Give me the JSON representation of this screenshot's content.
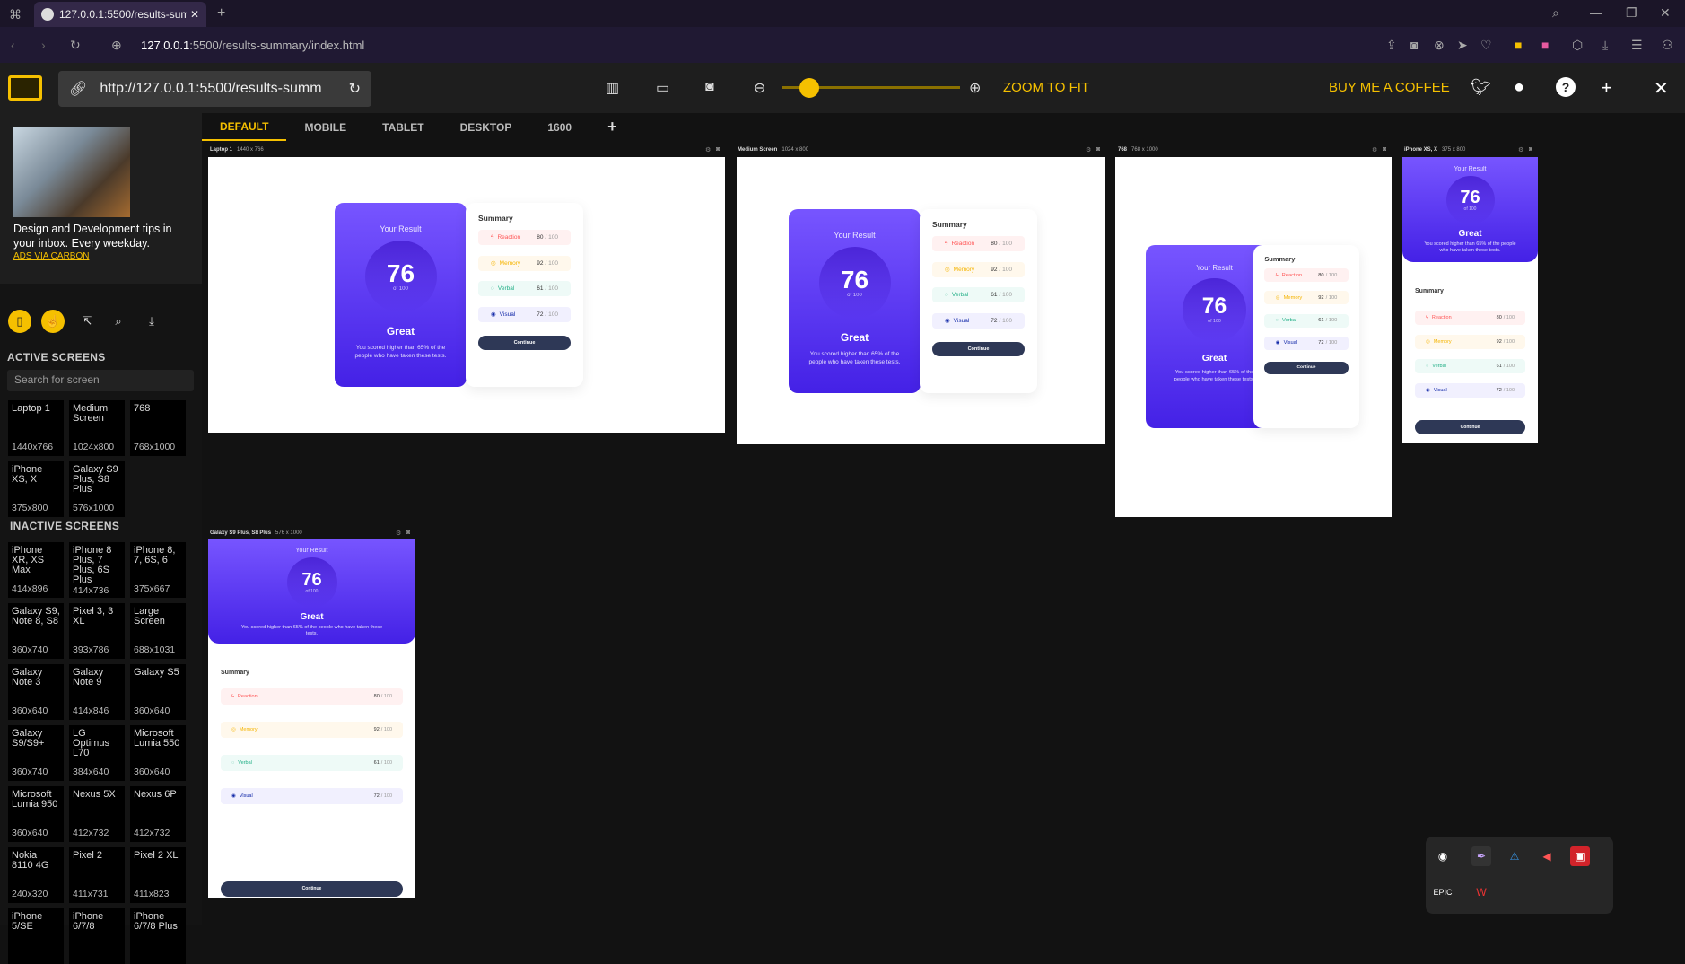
{
  "browser": {
    "tab_title": "127.0.0.1:5500/results-sum",
    "address_host": "127.0.0.1",
    "address_path": ":5500/results-summary/index.html"
  },
  "toolbar": {
    "url": "http://127.0.0.1:5500/results-summ",
    "zoom_label": "ZOOM TO FIT",
    "coffee_label": "BUY ME A COFFEE"
  },
  "view_tabs": [
    "DEFAULT",
    "MOBILE",
    "TABLET",
    "DESKTOP",
    "1600"
  ],
  "ad": {
    "text": "Design and Development tips in your inbox. Every weekday.",
    "link": "ADS VIA CARBON"
  },
  "sidebar": {
    "active_heading": "ACTIVE SCREENS",
    "search_placeholder": "Search for screen",
    "inactive_heading": "INACTIVE SCREENS",
    "active": [
      {
        "name": "Laptop 1",
        "size": "1440x766"
      },
      {
        "name": "Medium Screen",
        "size": "1024x800"
      },
      {
        "name": "768",
        "size": "768x1000"
      },
      {
        "name": "iPhone XS, X",
        "size": "375x800"
      },
      {
        "name": "Galaxy S9 Plus, S8 Plus",
        "size": "576x1000"
      }
    ],
    "inactive": [
      {
        "name": "iPhone XR, XS Max",
        "size": "414x896"
      },
      {
        "name": "iPhone 8 Plus, 7 Plus, 6S Plus",
        "size": "414x736"
      },
      {
        "name": "iPhone 8, 7, 6S, 6",
        "size": "375x667"
      },
      {
        "name": "Galaxy S9, Note 8, S8",
        "size": "360x740"
      },
      {
        "name": "Pixel 3, 3 XL",
        "size": "393x786"
      },
      {
        "name": "Large Screen",
        "size": "688x1031"
      },
      {
        "name": "Galaxy Note 3",
        "size": "360x640"
      },
      {
        "name": "Galaxy Note 9",
        "size": "414x846"
      },
      {
        "name": "Galaxy S5",
        "size": "360x640"
      },
      {
        "name": "Galaxy S9/S9+",
        "size": "360x740"
      },
      {
        "name": "LG Optimus L70",
        "size": "384x640"
      },
      {
        "name": "Microsoft Lumia 550",
        "size": "360x640"
      },
      {
        "name": "Microsoft Lumia 950",
        "size": "360x640"
      },
      {
        "name": "Nexus 5X",
        "size": "412x732"
      },
      {
        "name": "Nexus 6P",
        "size": "412x732"
      },
      {
        "name": "Nokia 8110 4G",
        "size": "240x320"
      },
      {
        "name": "Pixel 2",
        "size": "411x731"
      },
      {
        "name": "Pixel 2 XL",
        "size": "411x823"
      },
      {
        "name": "iPhone 5/SE",
        "size": ""
      },
      {
        "name": "iPhone 6/7/8",
        "size": ""
      },
      {
        "name": "iPhone 6/7/8 Plus",
        "size": ""
      }
    ]
  },
  "previews": [
    {
      "label": "Laptop 1",
      "size": "1440 x 766"
    },
    {
      "label": "Medium Screen",
      "size": "1024 x 800"
    },
    {
      "label": "768",
      "size": "768 x 1000"
    },
    {
      "label": "iPhone XS, X",
      "size": "375 x 800"
    },
    {
      "label": "Galaxy S9 Plus, S8 Plus",
      "size": "576 x 1000"
    }
  ],
  "result": {
    "your_result": "Your Result",
    "score": "76",
    "of": "of 100",
    "grade": "Great",
    "desc": "You scored higher than 65% of the people who have taken these tests.",
    "summary": "Summary",
    "items": [
      {
        "label": "Reaction",
        "score": "80",
        "max": "/ 100",
        "icon": "bolt-icon"
      },
      {
        "label": "Memory",
        "score": "92",
        "max": "/ 100",
        "icon": "brain-icon"
      },
      {
        "label": "Verbal",
        "score": "61",
        "max": "/ 100",
        "icon": "chat-icon"
      },
      {
        "label": "Visual",
        "score": "72",
        "max": "/ 100",
        "icon": "eye-icon"
      }
    ],
    "button": "Continue"
  }
}
